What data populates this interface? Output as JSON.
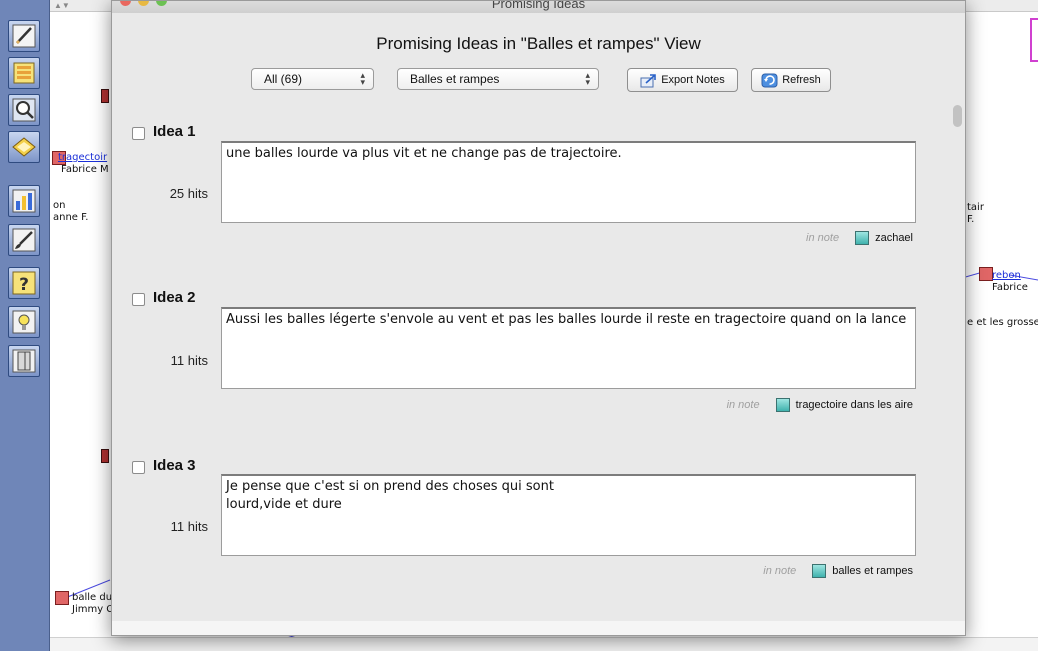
{
  "window": {
    "title": "Promising Ideas",
    "heading": "Promising Ideas in \"Balles et rampes\" View"
  },
  "toolbar": {
    "filter_value": "All (69)",
    "view_value": "Balles et rampes",
    "export_label": "Export Notes",
    "refresh_label": "Refresh"
  },
  "palette": {
    "tools": [
      "pencil-icon",
      "scaffold-icon",
      "search-icon",
      "notebook-icon",
      "chart-icon",
      "brush-icon",
      "help-icon",
      "lightbulb-icon",
      "door-icon"
    ]
  },
  "background": {
    "sort_arrows": "▲▼",
    "notes": [
      {
        "title": "tragectoir",
        "author": "Fabrice M"
      },
      {
        "title": "on",
        "author": "anne F."
      },
      {
        "title": "tair",
        "author": "F."
      },
      {
        "title": "rebon",
        "author": "Fabrice"
      },
      {
        "title": "e et les grosse",
        "author": ""
      },
      {
        "title": "balle du",
        "author": "Jimmy C"
      }
    ]
  },
  "ideas": [
    {
      "label": "Idea 1",
      "hits": "25 hits",
      "text": "une balles  lourde va plus vit et ne change pas de trajectoire.",
      "in_note": "in note",
      "note_title": "zachael"
    },
    {
      "label": "Idea 2",
      "hits": "11 hits",
      "text": "Aussi les balles légerte s'envole au vent et pas les balles lourde il reste en tragectoire quand on la lance",
      "in_note": "in note",
      "note_title": "tragectoire dans les aire"
    },
    {
      "label": "Idea 3",
      "hits": "11 hits",
      "text": "Je pense que c'est si on prend des choses qui sont\nlourd,vide et dure",
      "in_note": "in note",
      "note_title": "balles et rampes"
    }
  ],
  "colors": {
    "palette_bg": "#6f86b8",
    "note_square": "#e06666",
    "note_link": "#1a2fd8",
    "swatch": "#5cc7c2"
  }
}
